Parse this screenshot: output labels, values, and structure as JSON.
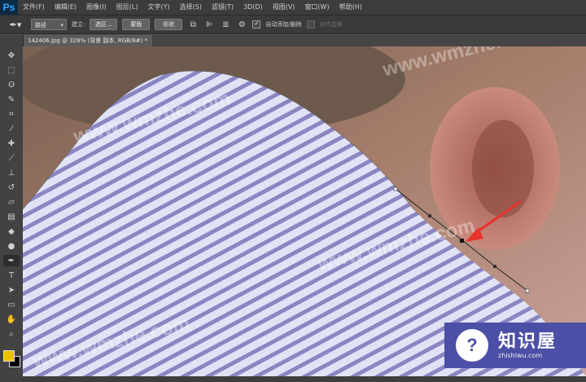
{
  "app": {
    "logo": "Ps"
  },
  "menu": [
    "文件(F)",
    "编辑(E)",
    "图像(I)",
    "图层(L)",
    "文字(Y)",
    "选择(S)",
    "滤镜(T)",
    "3D(D)",
    "视图(V)",
    "窗口(W)",
    "帮助(H)"
  ],
  "options": {
    "mode_select": "路径",
    "make_label": "建立:",
    "selection_btn": "选区...",
    "mask_btn": "蒙版",
    "shape_btn": "形状",
    "auto_add_delete": "自动添加/删除",
    "align_edges": "对齐边缘"
  },
  "document": {
    "tab_title": "142406.jpg @ 328% (背景 副本, RGB/8#) *"
  },
  "watermarks": [
    "www.wmzhe.com",
    "www.wmzhe.com",
    "www.wmzhe.com",
    "www.wmzhe.com"
  ],
  "badge": {
    "title": "知识屋",
    "subtitle": "zhishiwu.com"
  },
  "colors": {
    "foreground": "#f0c000",
    "background": "#000000",
    "arrow": "#e8322b"
  },
  "icons": {
    "tools": [
      "move-icon",
      "marquee-icon",
      "lasso-icon",
      "quick-select-icon",
      "crop-icon",
      "eyedropper-icon",
      "healing-icon",
      "brush-icon",
      "stamp-icon",
      "history-brush-icon",
      "eraser-icon",
      "gradient-icon",
      "blur-icon",
      "dodge-icon",
      "pen-icon",
      "type-icon",
      "path-select-icon",
      "shape-icon",
      "hand-icon",
      "zoom-icon"
    ]
  }
}
